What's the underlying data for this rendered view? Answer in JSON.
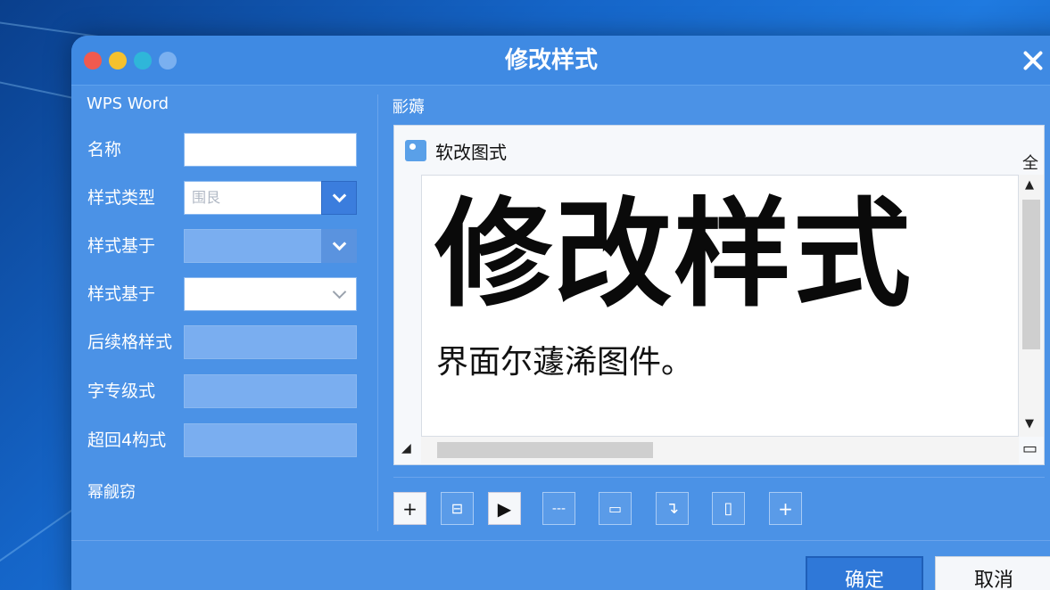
{
  "dialog": {
    "title": "修改样式",
    "window_controls": [
      {
        "name": "close-dot",
        "color": "#f05a4f"
      },
      {
        "name": "minimize-dot",
        "color": "#f5c12e"
      },
      {
        "name": "maximize-dot",
        "color": "#2fb6d9"
      },
      {
        "name": "extra-dot",
        "color": "#7ab0f0"
      }
    ],
    "close_icon": "close-icon"
  },
  "properties": {
    "section_title": "WPS Word",
    "fields": [
      {
        "label": "名称",
        "value": ""
      },
      {
        "label": "样式类型",
        "value": "围艮"
      },
      {
        "label": "样式基于",
        "value": ""
      },
      {
        "label": "样式基于",
        "value": ""
      },
      {
        "label": "后续格样式",
        "value": ""
      },
      {
        "label": "字专级式",
        "value": ""
      },
      {
        "label": "超回4构式",
        "value": ""
      }
    ],
    "footnote": "幂觎窃"
  },
  "preview": {
    "heading": "彨薅",
    "box_title": "软改图式",
    "expand_icon": "全",
    "big_text": "修改样式",
    "sub_text": "界面尔蘧浠图件。",
    "scroll_up": "▲",
    "scroll_down": "▼",
    "corner_left": "◢",
    "corner_right": "▭"
  },
  "toolbar": {
    "items": [
      {
        "name": "add-icon",
        "glyph": "+"
      },
      {
        "name": "format-icon",
        "glyph": "⊟"
      },
      {
        "name": "play-icon",
        "glyph": "▶"
      },
      {
        "name": "dashes-icon",
        "glyph": "---"
      },
      {
        "name": "frame-icon",
        "glyph": "▭"
      },
      {
        "name": "wrap-icon",
        "glyph": "↴"
      },
      {
        "name": "page-icon",
        "glyph": "▯"
      },
      {
        "name": "plus-icon",
        "glyph": "+"
      }
    ]
  },
  "buttons": {
    "ok": "确定",
    "cancel": "取消"
  }
}
